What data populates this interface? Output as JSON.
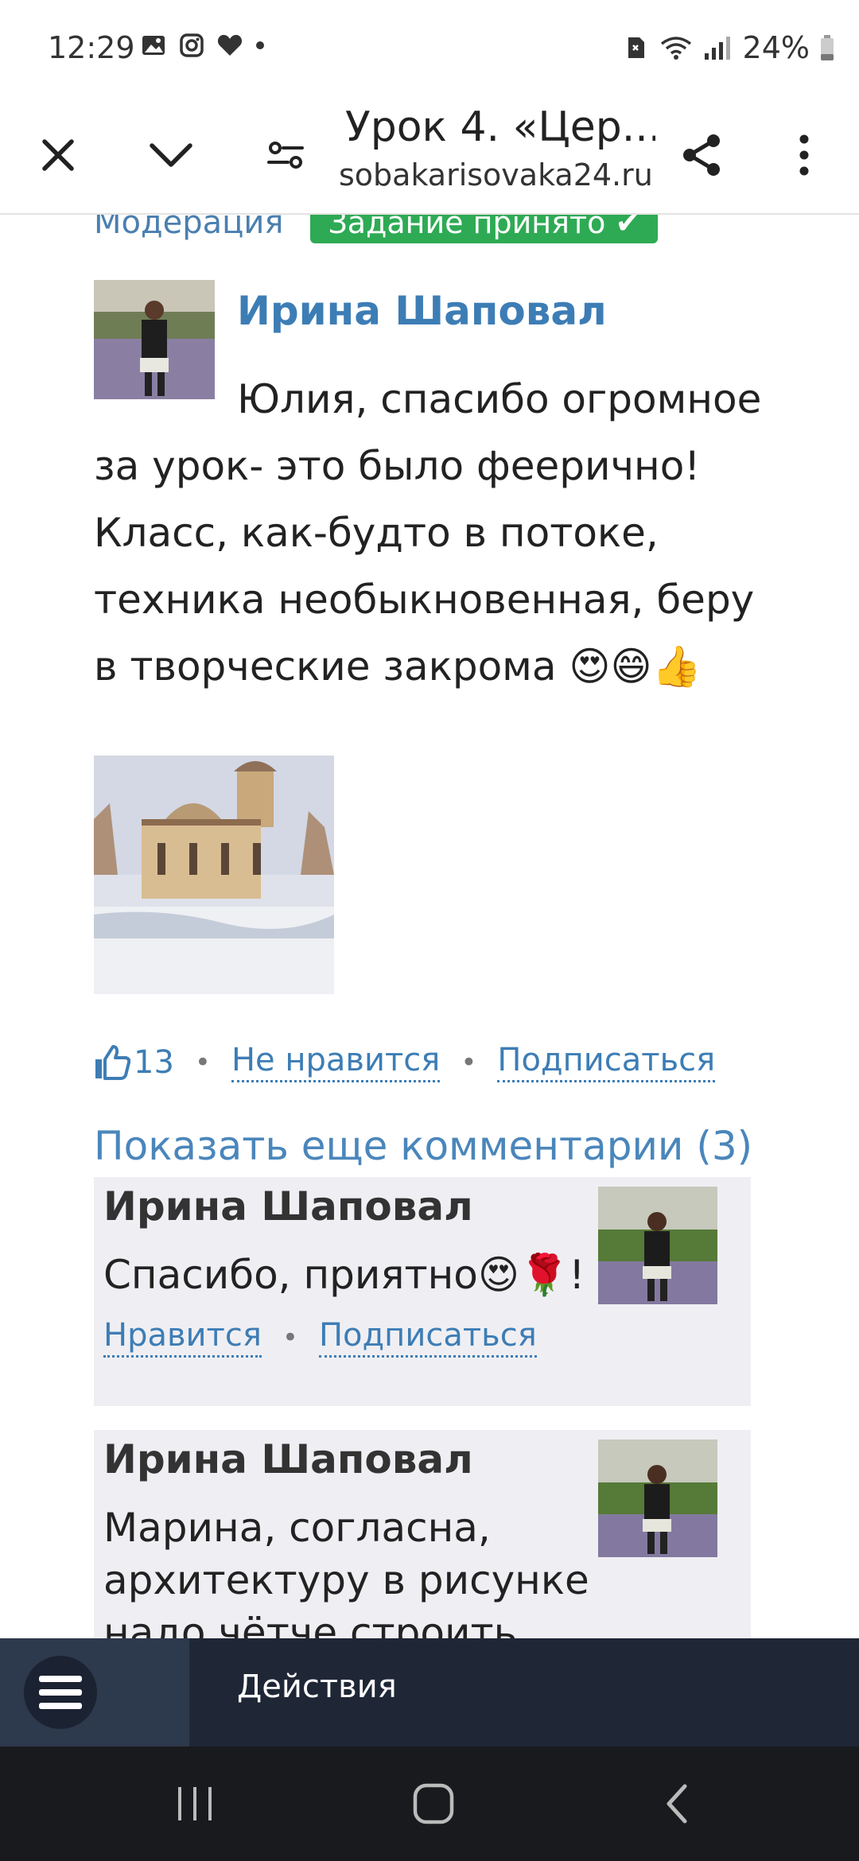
{
  "status_bar": {
    "time": "12:29",
    "battery": "24%"
  },
  "toolbar": {
    "title": "Урок 4. «Цер...",
    "url": "sobakarisovaka24.ru"
  },
  "partial": {
    "moderation": "Модерация",
    "accepted": "Задание принято ✔"
  },
  "post": {
    "author": "Ирина Шаповал",
    "text": "Юлия, спасибо огромное за урок- это было феерично! Класс, как-будто в потоке, техника необыкновенная, беру в творческие закрома 😍😄👍",
    "likes": "13",
    "dislike_label": "Не нравится",
    "subscribe_label": "Подписаться"
  },
  "more_comments": "Показать еще комментарии (3)",
  "replies": [
    {
      "author": "Ирина Шаповал",
      "text": "Спасибо, приятно😍🌹!",
      "like_label": "Нравится",
      "subscribe_label": "Подписаться"
    },
    {
      "author": "Ирина Шаповал",
      "text": "Марина, согласна, архитектуру в рисунке надо чётче строить, чтоб"
    }
  ],
  "actions_bar": {
    "label": "Действия"
  },
  "colors": {
    "link": "#3d7db5",
    "accepted_green": "#2eaa54",
    "actions_bar_bg": "#1f2636",
    "reply_bg": "#efeff3"
  }
}
